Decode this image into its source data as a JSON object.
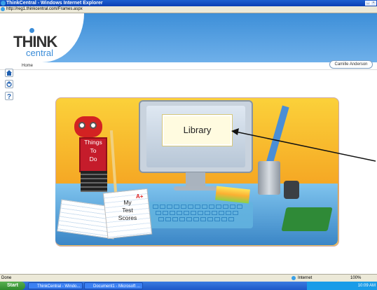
{
  "window": {
    "title": "ThinkCentral - Windows Internet Explorer",
    "url": "http://reg1.thinkcentral.com/Frames.aspx"
  },
  "header": {
    "logo_top": "THINK",
    "logo_bottom": "central"
  },
  "nav": {
    "breadcrumb": "Home",
    "user_name": "Camille Anderson"
  },
  "scene": {
    "robot_label_lines": [
      "Things",
      "To",
      "Do"
    ],
    "library_label": "Library",
    "scores_label_lines": [
      "My",
      "Test",
      "Scores"
    ],
    "grade_mark": "A+"
  },
  "status": {
    "left": "Done",
    "zone": "Internet",
    "zoom": "100%"
  },
  "taskbar": {
    "start": "Start",
    "tasks": [
      "ThinkCentral - Windo...",
      "Document1 - Microsoft ..."
    ],
    "time": "10:09 AM"
  }
}
